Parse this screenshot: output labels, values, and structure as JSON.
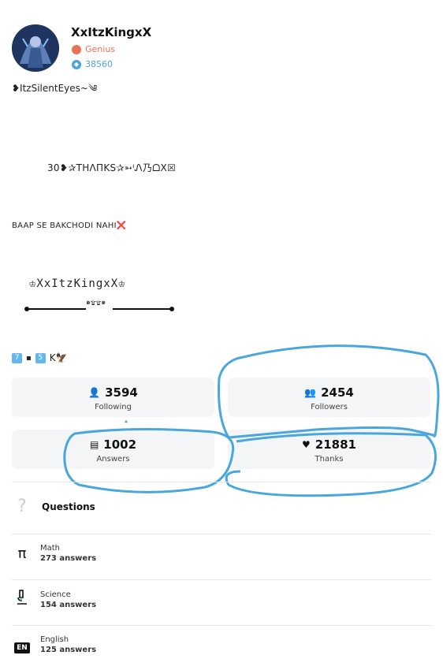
{
  "profile": {
    "username": "XxItzKingxX",
    "rank": "Genius",
    "points": "38560"
  },
  "bio": {
    "line1": "❥ItzSilentEyes~༄",
    "line2": "30❥✰THΛПKS✰➳ᴵᏁ乃ᗝX☒",
    "line3": "BAAP SE BAKCHODI NAHI❌",
    "line4": "♔XxItzKingxX♔",
    "divider_glyph": "๑۩۩๑",
    "line5": "K🦅"
  },
  "stats": {
    "following": {
      "count": "3594",
      "label": "Following"
    },
    "followers": {
      "count": "2454",
      "label": "Followers"
    },
    "answers": {
      "count": "1002",
      "label": "Answers"
    },
    "thanks": {
      "count": "21881",
      "label": "Thanks"
    }
  },
  "menu": {
    "questions_label": "Questions"
  },
  "subjects": [
    {
      "name": "Math",
      "count": "273 answers",
      "icon": "pi-icon"
    },
    {
      "name": "Science",
      "count": "154 answers",
      "icon": "microscope-icon"
    },
    {
      "name": "English",
      "count": "125 answers",
      "icon": "en-badge-icon",
      "badge": "EN"
    }
  ],
  "colors": {
    "rank": "#e8735a",
    "points": "#4fa3dd",
    "annotation": "#4aa7dc"
  }
}
